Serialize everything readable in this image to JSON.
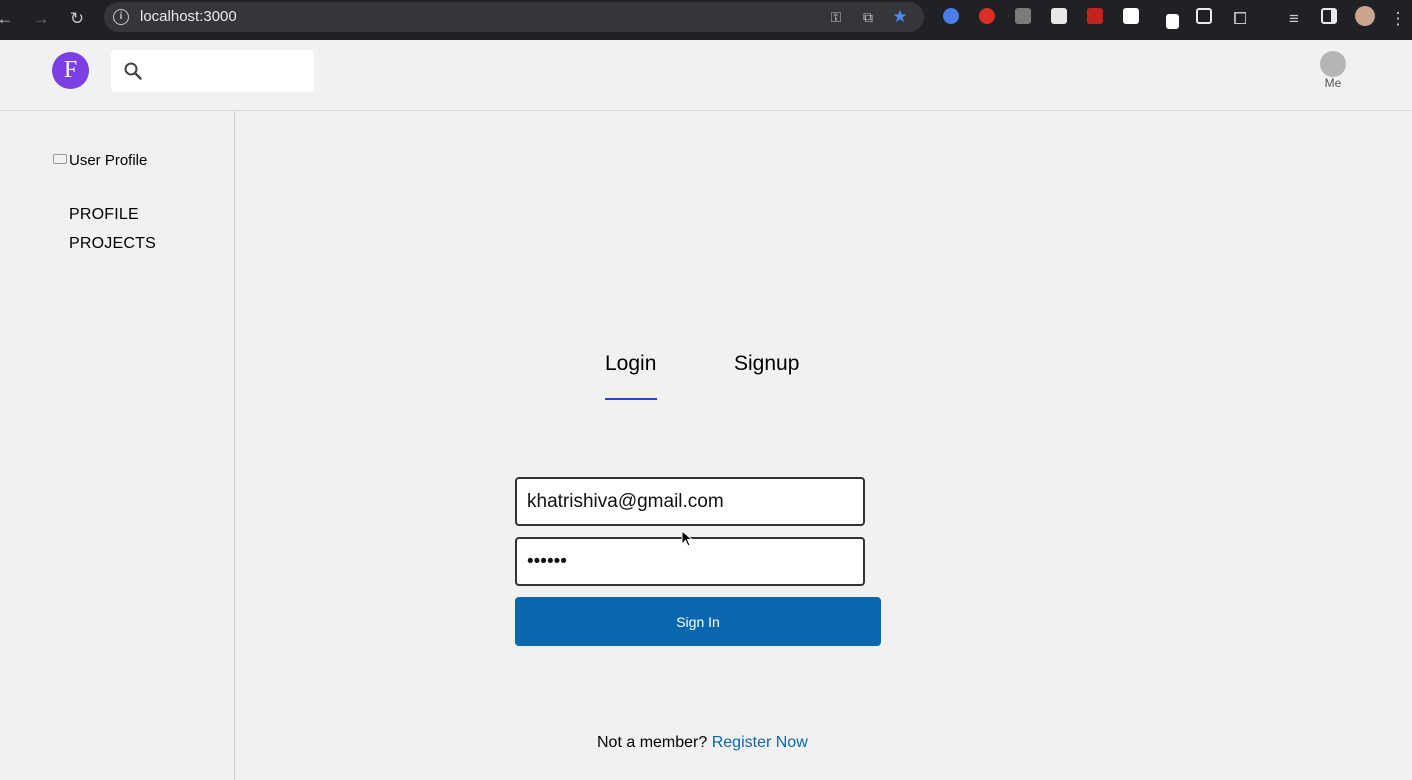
{
  "browser": {
    "url": "localhost:3000",
    "back_icon": "arrow-left-icon",
    "forward_icon": "arrow-right-icon",
    "reload_icon": "reload-icon",
    "info_icon": "info-icon",
    "key_icon": "key-icon",
    "install_icon": "install-app-icon",
    "star_icon": "bookmark-star-icon",
    "star_color": "#4c8bf5"
  },
  "header": {
    "logo_letter": "F",
    "logo_color": "#7b3fe4",
    "search": {
      "value": "",
      "placeholder": ""
    },
    "me_label": "Me"
  },
  "sidebar": {
    "profile_image_alt": "User Profile",
    "links": [
      "PROFILE",
      "PROJECTS"
    ]
  },
  "auth": {
    "tabs": [
      {
        "label": "Login",
        "active": true
      },
      {
        "label": "Signup",
        "active": false
      }
    ],
    "email_value": "khatrishiva@gmail.com",
    "password_value": "••••••",
    "sign_in_label": "Sign In",
    "button_color": "#0a66ad",
    "footer_prompt": "Not a member?",
    "register_link": "Register Now"
  }
}
